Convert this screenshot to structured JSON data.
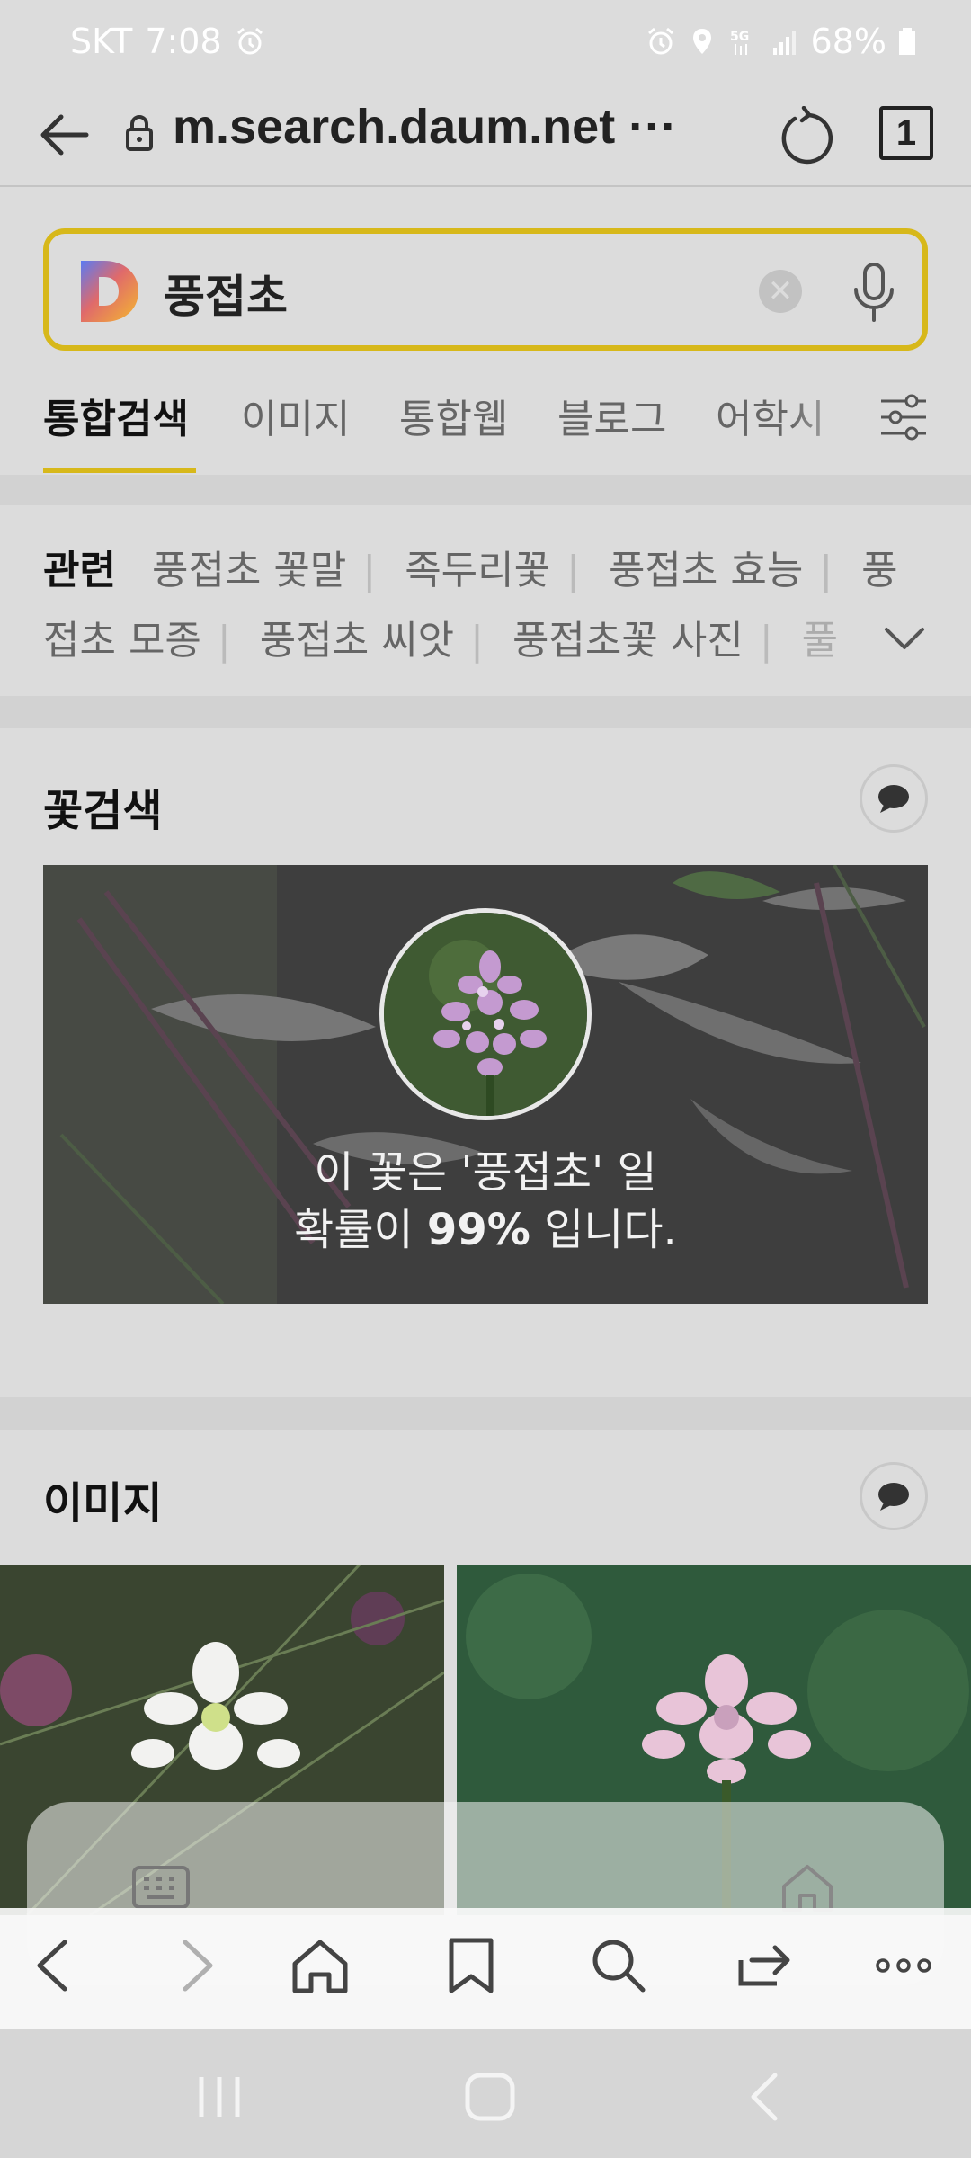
{
  "status_bar": {
    "carrier": "SKT",
    "time": "7:08",
    "battery": "68%",
    "icons": [
      "alarm-icon",
      "location-icon",
      "5g-icon",
      "signal-icon",
      "battery-icon"
    ]
  },
  "url_bar": {
    "url": "m.search.daum.net ···",
    "tab_count": "1"
  },
  "search": {
    "query": "풍접초",
    "accent_color": "#d7b81a"
  },
  "tabs": [
    {
      "label": "통합검색",
      "active": true
    },
    {
      "label": "이미지"
    },
    {
      "label": "통합웹"
    },
    {
      "label": "블로그"
    },
    {
      "label": "어학시"
    }
  ],
  "related": {
    "label": "관련",
    "line1": [
      "풍접초 꽃말",
      "족두리꽃",
      "풍접초 효능",
      "풍"
    ],
    "line2": [
      "접초 모종",
      "풍접초 씨앗",
      "풍접초꽃 사진",
      "풀"
    ]
  },
  "flower_search": {
    "title": "꽃검색",
    "line1": "이 꽃은 '풍접초' 일",
    "line2_prefix": "확률이 ",
    "line2_percent": "99%",
    "line2_suffix": " 입니다."
  },
  "images": {
    "title": "이미지"
  }
}
